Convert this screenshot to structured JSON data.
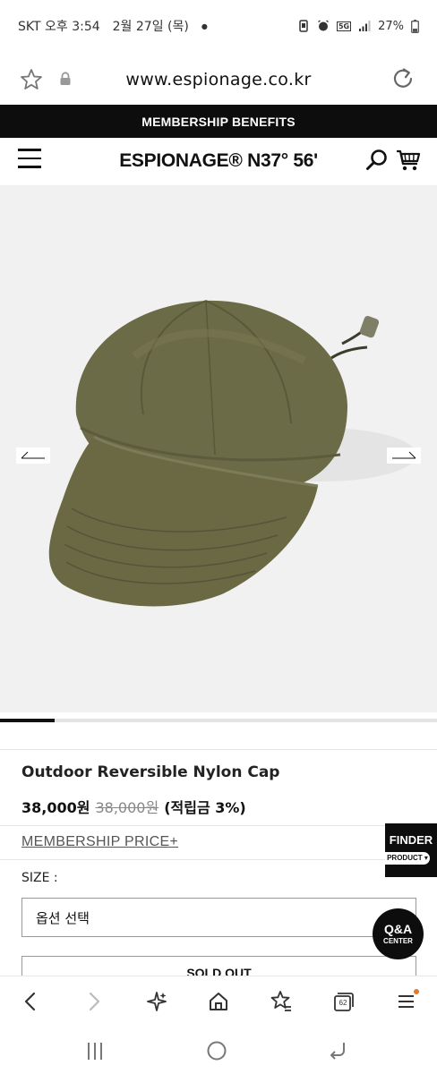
{
  "status_bar": {
    "carrier_time": "SKT 오후 3:54",
    "date": "2월 27일 (목)",
    "battery": "27%",
    "network": "5G"
  },
  "browser": {
    "url": "www.espionage.co.kr",
    "tab_count": "62"
  },
  "site": {
    "banner": "MEMBERSHIP BENEFITS",
    "logo": "ESPIONAGE® N37° 56'"
  },
  "gallery": {
    "progress": 0.125
  },
  "product": {
    "name": "Outdoor Reversible Nylon Cap",
    "price": "38,000원",
    "original_price": "38,000원",
    "points": "(적립금 3%)",
    "membership_link": "MEMBERSHIP PRICE+",
    "size_label": "SIZE :",
    "option_placeholder": "옵션 선택",
    "sold_out_label": "SOLD OUT"
  },
  "floating": {
    "finder_title": "FINDER",
    "finder_sub": "PRODUCT ▾",
    "qa_title": "Q&A",
    "qa_sub": "CENTER"
  },
  "colors": {
    "banner_bg": "#0d0d0d",
    "hero_bg": "#f1f1f1",
    "cap_olive": "#6b6a45"
  },
  "icons": {
    "url_bar": [
      "star-icon",
      "lock-icon",
      "reload-icon"
    ],
    "header": [
      "menu-icon",
      "search-icon",
      "cart-icon"
    ],
    "toolbar": [
      "back-icon",
      "forward-icon",
      "sparkle-icon",
      "home-icon",
      "bookmark-star-icon",
      "tabs-icon",
      "menu-icon"
    ],
    "nav": [
      "recents-icon",
      "home-circle-icon",
      "back-arrow-icon"
    ]
  }
}
